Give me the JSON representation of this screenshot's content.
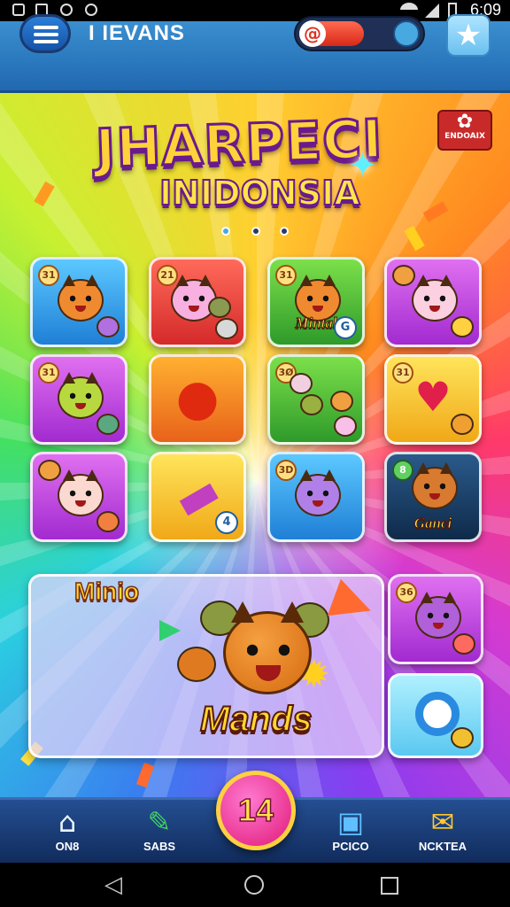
{
  "status_bar": {
    "time": "6:09"
  },
  "header": {
    "title": "I IEVANS",
    "progress": 0.55
  },
  "logo": {
    "line1": "JHARPECI",
    "line2": "INIDONSIA"
  },
  "event_badge": {
    "label": "ENDOAIX"
  },
  "carousel": {
    "dots": 3
  },
  "tiles": [
    {
      "number": "31"
    },
    {
      "number": "21"
    },
    {
      "number": "31",
      "label": "Mintal",
      "badge": "G"
    },
    {},
    {
      "number": "31"
    },
    {},
    {
      "number": "3Ø"
    },
    {
      "number": "31"
    },
    {},
    {
      "badge": "4"
    },
    {
      "number": "3D"
    },
    {
      "number": "8",
      "label": "Ganci"
    }
  ],
  "featured": {
    "title": "Minio",
    "name": "Mands"
  },
  "side_tile": {
    "number": "36"
  },
  "bottom_nav": {
    "items": [
      {
        "label": "ON8",
        "icon": "home-icon"
      },
      {
        "label": "SABS",
        "icon": "ruler-icon"
      },
      {
        "label": "PCICO",
        "icon": "tv-icon"
      },
      {
        "label": "NCKTEA",
        "icon": "envelope-icon"
      }
    ],
    "center": "14"
  },
  "colors": {
    "accent": "#e01878",
    "header": "#2a7cc4",
    "nav": "#183c78"
  }
}
